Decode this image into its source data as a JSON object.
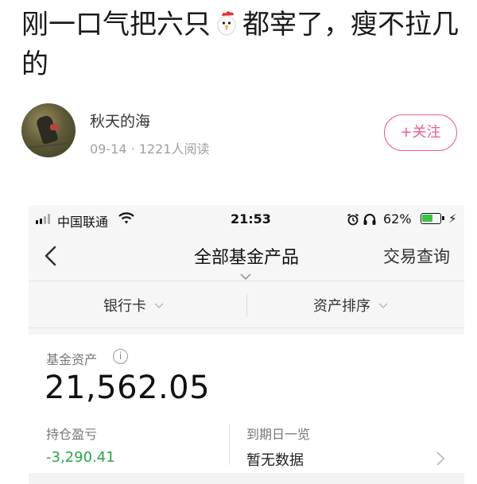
{
  "post": {
    "title_part1": "刚一口气把六只",
    "title_part2": "都宰了，瘦不拉几的"
  },
  "author": {
    "name": "秋天的海",
    "meta": "09-14 · 1221人阅读",
    "follow_label": "+关注"
  },
  "screenshot": {
    "statusbar": {
      "carrier": "中国联通",
      "time": "21:53",
      "battery_pct": "62%",
      "battery_level": 0.62,
      "icons": [
        "signal-icon",
        "wifi-icon",
        "alarm-icon",
        "headphone-icon",
        "battery-icon",
        "charging-bolt-icon"
      ]
    },
    "navbar": {
      "title": "全部基金产品",
      "action": "交易查询"
    },
    "filters": {
      "bank_card": "银行卡",
      "asset_sort": "资产排序"
    },
    "assets": {
      "label": "基金资产",
      "info_glyph": "i",
      "value": "21,562.05",
      "pl_label": "持仓盈亏",
      "pl_value": "-3,290.41",
      "due_label": "到期日一览",
      "due_value": "暂无数据"
    },
    "colors": {
      "follow_accent": "#ef5b8f",
      "loss_green": "#2aa64a",
      "battery_green": "#36c441"
    }
  }
}
